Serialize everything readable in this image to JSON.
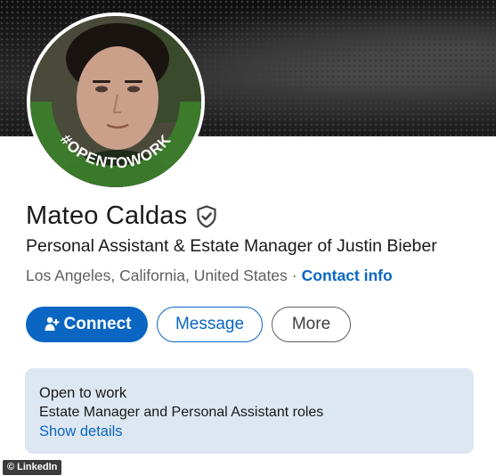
{
  "profile": {
    "name": "Mateo Caldas",
    "headline": "Personal Assistant & Estate Manager of Justin Bieber",
    "location": "Los Angeles, California, United States",
    "separator": "·",
    "contact_info_label": "Contact info",
    "avatar_badge_text": "#OPENTOWORK",
    "verified_icon": "shield-check-icon"
  },
  "actions": {
    "connect_label": "Connect",
    "message_label": "Message",
    "more_label": "More"
  },
  "open_to_work": {
    "title": "Open to work",
    "roles": "Estate Manager and Personal Assistant roles",
    "show_details_label": "Show details"
  },
  "watermark": {
    "text": "© LinkedIn"
  },
  "colors": {
    "brand_blue": "#0a66c2",
    "otw_green": "#3b7d2a",
    "card_bg": "#dde7f1"
  }
}
